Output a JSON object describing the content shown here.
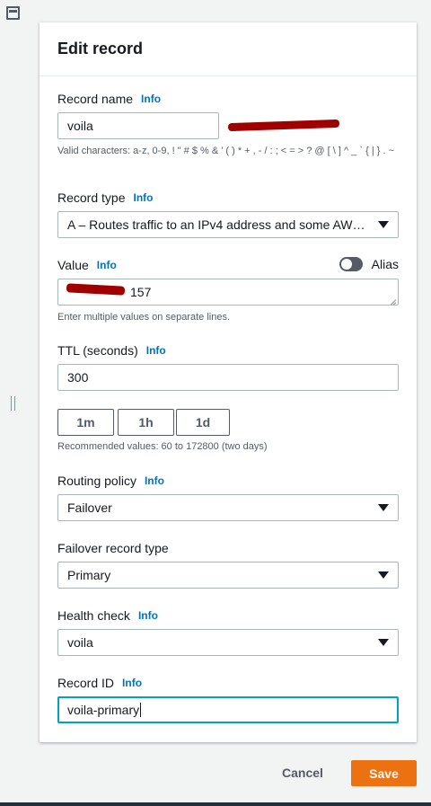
{
  "panel": {
    "title": "Edit record"
  },
  "info_label": "Info",
  "record_name": {
    "label": "Record name",
    "value": "voila",
    "hint": "Valid characters: a-z, 0-9, ! \" # $ % & ' ( ) * + , - / : ; < = > ? @ [ \\ ] ^ _ ` { | } . ~"
  },
  "record_type": {
    "label": "Record type",
    "selected": "A – Routes traffic to an IPv4 address and some AWS resources"
  },
  "value": {
    "label": "Value",
    "alias_label": "Alias",
    "alias_on": false,
    "visible_suffix": "157",
    "hint": "Enter multiple values on separate lines."
  },
  "ttl": {
    "label": "TTL (seconds)",
    "value": "300",
    "buttons": [
      "1m",
      "1h",
      "1d"
    ],
    "hint": "Recommended values: 60 to 172800 (two days)"
  },
  "routing_policy": {
    "label": "Routing policy",
    "selected": "Failover"
  },
  "failover_type": {
    "label": "Failover record type",
    "selected": "Primary"
  },
  "health_check": {
    "label": "Health check",
    "selected": "voila"
  },
  "record_id": {
    "label": "Record ID",
    "value": "voila-primary"
  },
  "footer": {
    "cancel": "Cancel",
    "save": "Save"
  },
  "colors": {
    "primary_button": "#ec7211",
    "info_link": "#0073bb",
    "focus": "#00a1c9",
    "redaction": "#a00000"
  }
}
